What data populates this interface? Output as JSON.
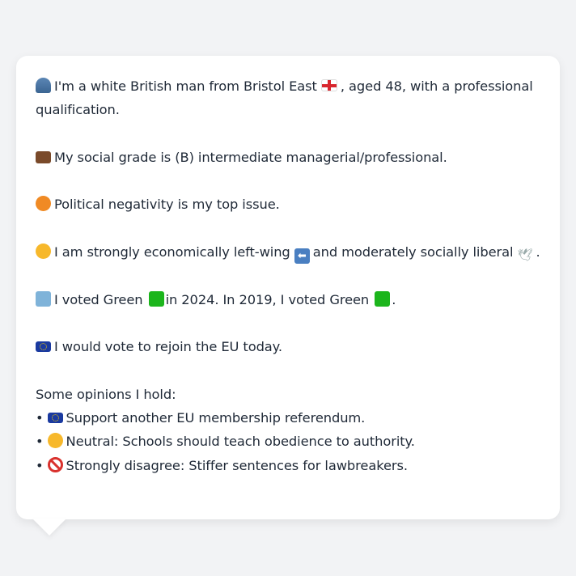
{
  "profile": {
    "intro": {
      "icon": "person-icon",
      "text_a": "I'm a white British man from Bristol East",
      "flag": "england-flag-icon",
      "text_b": ", aged 48, with a professional qualification."
    },
    "grade": {
      "icon": "briefcase-icon",
      "text": "My social grade is (B) intermediate managerial/professional."
    },
    "issue": {
      "icon": "angry-face-icon",
      "text": "Political negativity is my top issue."
    },
    "ideology": {
      "icon": "thinking-face-icon",
      "text_a": "I am strongly economically left-wing",
      "arrow": "left-arrow-icon",
      "arrow_glyph": "⬅",
      "text_b": "and moderately socially liberal",
      "dove": "dove-icon",
      "dove_glyph": "🕊",
      "text_c": "."
    },
    "vote": {
      "icon": "ballot-box-icon",
      "text_a": "I voted Green",
      "text_b": "in 2024. In 2019, I voted Green",
      "text_c": ".",
      "party_color": "#1cb51c"
    },
    "eu": {
      "icon": "eu-flag-icon",
      "text": "I would vote to rejoin the EU today."
    },
    "opinions_heading": "Some opinions I hold:",
    "opinions": [
      {
        "bullet": "•",
        "icon": "eu-flag-icon",
        "text": "Support another EU membership referendum."
      },
      {
        "bullet": "•",
        "icon": "neutral-face-icon",
        "text": "Neutral: Schools should teach obedience to authority."
      },
      {
        "bullet": "•",
        "icon": "prohibited-icon",
        "text": "Strongly disagree: Stiffer sentences for lawbreakers."
      }
    ]
  }
}
